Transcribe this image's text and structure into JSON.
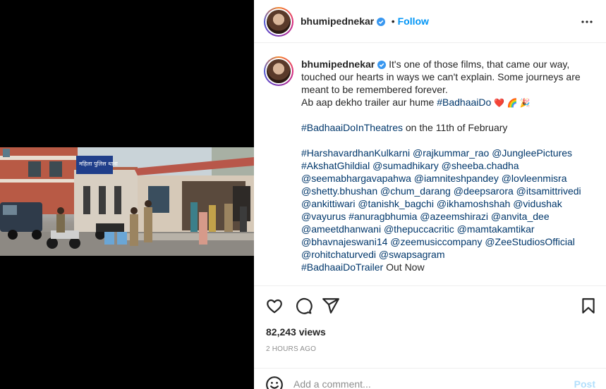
{
  "header": {
    "username": "bhumipednekar",
    "separator": "•",
    "follow_label": "Follow"
  },
  "caption": {
    "username": "bhumipednekar",
    "line1": "It's one of those films, that came our way,",
    "line2": "touched our hearts in ways we can't explain. Some journeys are",
    "line3": "meant to be remembered forever.",
    "line4_text": "Ab aap dekho trailer aur hume ",
    "line4_tag": "#BadhaaiDo",
    "line4_emoji": "❤️ 🌈 🎉",
    "line5_tag": "#BadhaaiDoInTheatres",
    "line5_text": " on the 11th of February",
    "mentions": [
      "#HarshavardhanKulkarni @rajkummar_rao @JungleePictures",
      "#AkshatGhildial @sumadhikary @sheeba.chadha",
      "@seemabhargavapahwa @iamniteshpandey @lovleenmisra",
      "@shetty.bhushan @chum_darang @deepsarora @itsamittrivedi",
      "@ankittiwari @tanishk_bagchi @ikhamoshshah @vidushak",
      "@vayurus #anuragbhumia @azeemshirazi @anvita_dee",
      "@ameetdhanwani @thepuccacritic @mamtakamtikar",
      "@bhavnajeswani14 @zeemusiccompany @ZeeStudiosOfficial",
      "@rohitchaturvedi @swapsagram"
    ],
    "last_tag": "#BadhaaiDoTrailer",
    "last_text": " Out Now"
  },
  "media": {
    "sign_text": "महिला पुलिस थाना"
  },
  "stats": {
    "views": "82,243 views",
    "time_ago": "2 HOURS AGO"
  },
  "comment": {
    "placeholder": "Add a comment...",
    "post_label": "Post"
  },
  "colors": {
    "link": "#00376b",
    "follow": "#0095f6",
    "post_disabled": "#b2dffc",
    "verified": "#3897f0",
    "muted": "#8e8e8e"
  },
  "icons": {
    "more": "more-options-icon",
    "like": "heart-icon",
    "comment": "comment-icon",
    "share": "share-icon",
    "save": "bookmark-icon",
    "emoji": "emoji-icon",
    "verified": "verified-badge-icon"
  }
}
